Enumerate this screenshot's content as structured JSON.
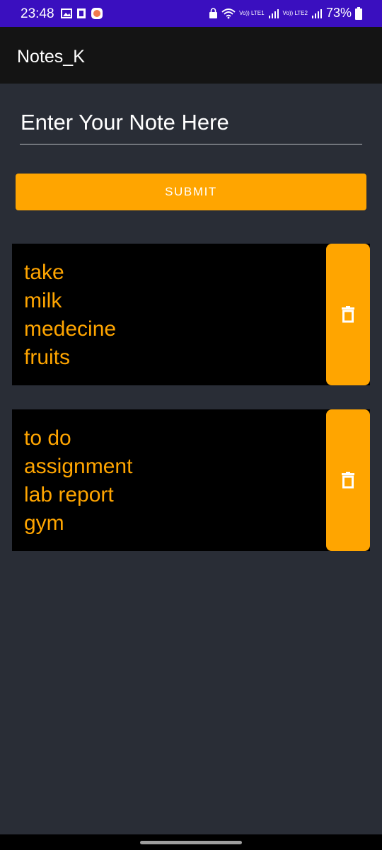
{
  "status_bar": {
    "time": "23:48",
    "battery": "73%",
    "sim1_label": "Vo)) LTE1",
    "sim2_label": "Vo)) LTE2",
    "icons": [
      "gallery-icon",
      "sim-icon",
      "app-notification-icon",
      "lock-icon",
      "wifi-icon",
      "signal-icon",
      "battery-icon"
    ],
    "background": "#3a0fbf"
  },
  "app_bar": {
    "title": "Notes_K"
  },
  "note_input": {
    "placeholder": "Enter Your Note Here",
    "value": ""
  },
  "submit_button": {
    "label": "SUBMIT"
  },
  "notes": [
    {
      "text": "take\nmilk\nmedecine\nfruits",
      "delete_icon": "trash-icon"
    },
    {
      "text": "to do\nassignment\nlab report\ngym",
      "delete_icon": "trash-icon"
    }
  ],
  "colors": {
    "accent": "#ffa500",
    "background": "#292d36",
    "app_bar": "#141414",
    "card": "#000000"
  }
}
